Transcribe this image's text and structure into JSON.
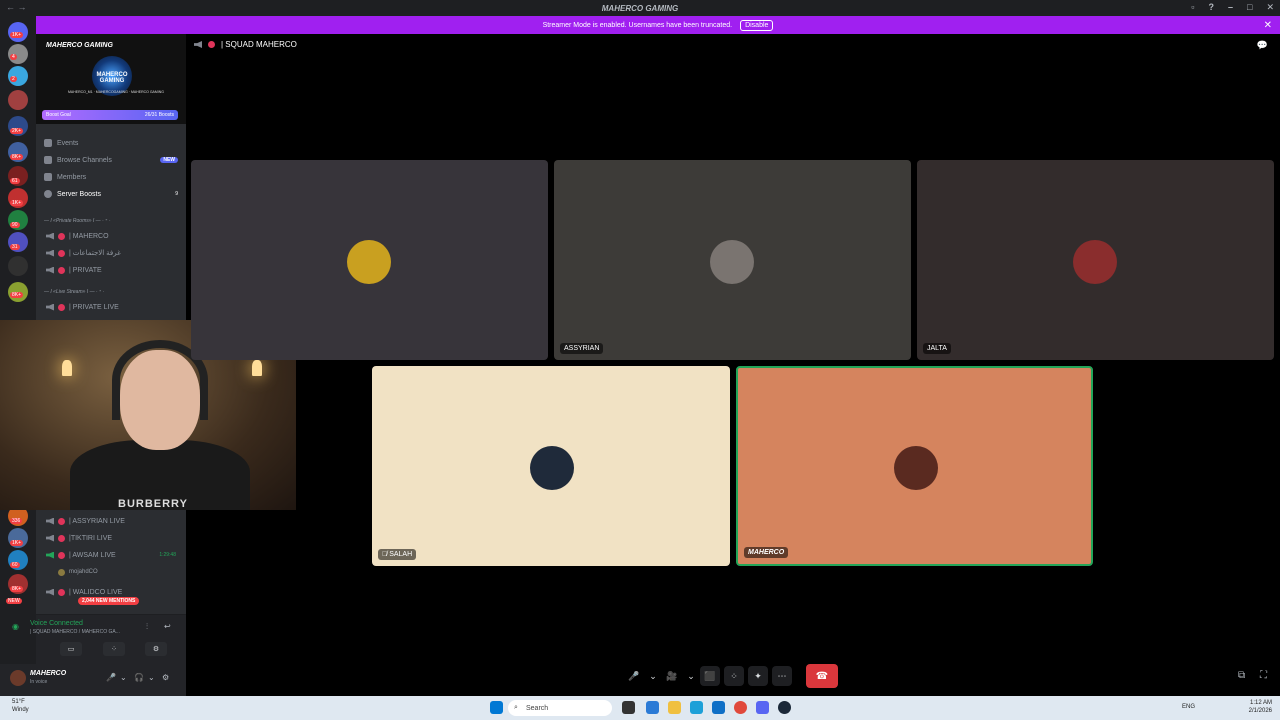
{
  "window": {
    "title": "MAHERCO GAMING",
    "nav": "← →",
    "controls": [
      "▫",
      "?",
      "–",
      "□",
      "✕"
    ]
  },
  "banner": {
    "message": "Streamer Mode is enabled. Usernames have been truncated.",
    "disable_label": "Disable",
    "close": "✕"
  },
  "guild_badges": [
    "1K+",
    "4",
    "2",
    "2K+",
    "8K+",
    "61",
    "1K+",
    "90",
    "31",
    "8K+",
    "336",
    "1K+",
    "60",
    "8K+",
    "NEW"
  ],
  "server": {
    "name": "MAHERCO GAMING",
    "logo_text": "MAHERCO GAMING",
    "subtext": "MAHERCO_M1 · MAHERCOGAMING · MAHERCO GAMING",
    "boost_goal_label": "Boost Goal",
    "boost_goal_value": "26/31 Boosts"
  },
  "menu": {
    "events": "Events",
    "browse": "Browse Channels",
    "browse_badge": "NEW",
    "members": "Members",
    "boosts": "Server Boosts",
    "boosts_count": "9"
  },
  "categories": {
    "private_rooms": "— I «Private Rooms» I — · ⁃ ·",
    "live_stream": "— I «Live Stream» I — · ⁃ ·"
  },
  "channels_top": [
    {
      "name": "| MAHERCO"
    },
    {
      "name": "| غرفة الاجتماعات"
    },
    {
      "name": "| PRIVATE"
    },
    {
      "name": "| PRIVATE LIVE"
    }
  ],
  "channels_bottom": [
    {
      "name": "| ASSYRIAN LIVE",
      "timer": ""
    },
    {
      "name": "|TIKTIRI LIVE",
      "timer": ""
    },
    {
      "name": "| AWSAM LIVE",
      "timer": "1:29:48"
    },
    {
      "name": "mojahdCO",
      "timer": ""
    },
    {
      "name": "| WALIDCO LIVE",
      "timer": ""
    }
  ],
  "webcam_watermark": "BURBERRY",
  "mentions_badge": "2,044 NEW MENTIONS",
  "voice": {
    "status": "Voice Connected",
    "room": "| SQUAD MAHERCO / MAHERCO GA...",
    "buttons": [
      "▭",
      "⁘",
      "⚙"
    ]
  },
  "user": {
    "name": "MAHERCO",
    "status": "In voice",
    "controls": [
      "🎤",
      "⌄",
      "🎧",
      "⌄",
      "⚙"
    ]
  },
  "channel_header": {
    "name": "| SQUAD MAHERCO"
  },
  "tiles": [
    {
      "label": "",
      "bg": "#37343a",
      "avatar": "#c9a020"
    },
    {
      "label": "ASSYRIAN",
      "bg": "#3d3b38",
      "avatar": "#7a7470"
    },
    {
      "label": "JALTA",
      "bg": "#332c2c",
      "avatar": "#8a2d2d"
    },
    {
      "label": "SALAH",
      "bg": "#f1e2c4",
      "avatar": "#1f2a3a",
      "muted": true
    },
    {
      "label": "MAHERCO",
      "bg": "#d5845e",
      "avatar": "#5a2a20",
      "speaking": true
    }
  ],
  "call_controls": [
    "🎤",
    "⌄",
    "🎥",
    "⌄",
    "⬛",
    "⁘",
    "✦",
    "⋯"
  ],
  "hangup_icon": "☎",
  "taskbar": {
    "weather_temp": "51°F",
    "weather_desc": "Windy",
    "search": "Search",
    "lang": "ENG",
    "time": "1:12 AM",
    "date": "2/1/2026"
  },
  "colors": {
    "banner": "#a020f0",
    "accent": "#5865f2",
    "danger": "#da373c",
    "voice_green": "#23a559"
  }
}
